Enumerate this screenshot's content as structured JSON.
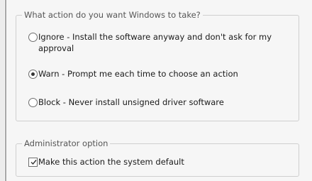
{
  "action_group": {
    "legend": "What action do you want Windows to take?",
    "options": [
      {
        "label": "Ignore - Install the software anyway and don't ask for my approval",
        "selected": false
      },
      {
        "label": "Warn - Prompt me each time to choose an action",
        "selected": true
      },
      {
        "label": "Block - Never install unsigned driver software",
        "selected": false
      }
    ]
  },
  "admin_group": {
    "legend": "Administrator option",
    "checkbox_label": "Make this action the system default",
    "checked": true
  }
}
